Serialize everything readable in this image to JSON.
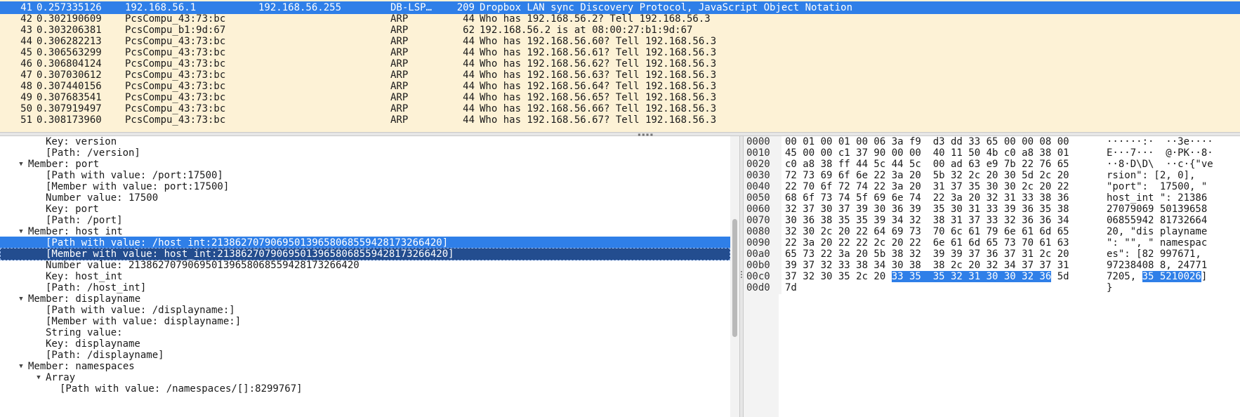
{
  "packet_list": {
    "rows": [
      {
        "no": "41",
        "time": "0.257335126",
        "src": "192.168.56.1",
        "dst": "192.168.56.255",
        "proto": "DB-LSP…",
        "len": "209",
        "info": "Dropbox LAN sync Discovery Protocol, JavaScript Object Notation",
        "selected": true
      },
      {
        "no": "42",
        "time": "0.302190609",
        "src": "PcsCompu_43:73:bc",
        "dst": "",
        "proto": "ARP",
        "len": "44",
        "info": "Who has 192.168.56.2? Tell 192.168.56.3"
      },
      {
        "no": "43",
        "time": "0.303206381",
        "src": "PcsCompu_b1:9d:67",
        "dst": "",
        "proto": "ARP",
        "len": "62",
        "info": "192.168.56.2 is at 08:00:27:b1:9d:67"
      },
      {
        "no": "44",
        "time": "0.306282213",
        "src": "PcsCompu_43:73:bc",
        "dst": "",
        "proto": "ARP",
        "len": "44",
        "info": "Who has 192.168.56.60? Tell 192.168.56.3"
      },
      {
        "no": "45",
        "time": "0.306563299",
        "src": "PcsCompu_43:73:bc",
        "dst": "",
        "proto": "ARP",
        "len": "44",
        "info": "Who has 192.168.56.61? Tell 192.168.56.3"
      },
      {
        "no": "46",
        "time": "0.306804124",
        "src": "PcsCompu_43:73:bc",
        "dst": "",
        "proto": "ARP",
        "len": "44",
        "info": "Who has 192.168.56.62? Tell 192.168.56.3"
      },
      {
        "no": "47",
        "time": "0.307030612",
        "src": "PcsCompu_43:73:bc",
        "dst": "",
        "proto": "ARP",
        "len": "44",
        "info": "Who has 192.168.56.63? Tell 192.168.56.3"
      },
      {
        "no": "48",
        "time": "0.307440156",
        "src": "PcsCompu_43:73:bc",
        "dst": "",
        "proto": "ARP",
        "len": "44",
        "info": "Who has 192.168.56.64? Tell 192.168.56.3"
      },
      {
        "no": "49",
        "time": "0.307683541",
        "src": "PcsCompu_43:73:bc",
        "dst": "",
        "proto": "ARP",
        "len": "44",
        "info": "Who has 192.168.56.65? Tell 192.168.56.3"
      },
      {
        "no": "50",
        "time": "0.307919497",
        "src": "PcsCompu_43:73:bc",
        "dst": "",
        "proto": "ARP",
        "len": "44",
        "info": "Who has 192.168.56.66? Tell 192.168.56.3"
      },
      {
        "no": "51",
        "time": "0.308173960",
        "src": "PcsCompu_43:73:bc",
        "dst": "",
        "proto": "ARP",
        "len": "44",
        "info": "Who has 192.168.56.67? Tell 192.168.56.3"
      }
    ]
  },
  "details": {
    "rows": [
      {
        "text": "Key: version",
        "depth": 2,
        "arrow": ""
      },
      {
        "text": "[Path: /version]",
        "depth": 2,
        "arrow": ""
      },
      {
        "text": "Member: port",
        "depth": 1,
        "arrow": "down"
      },
      {
        "text": "[Path with value: /port:17500]",
        "depth": 2,
        "arrow": ""
      },
      {
        "text": "[Member with value: port:17500]",
        "depth": 2,
        "arrow": ""
      },
      {
        "text": "Number value: 17500",
        "depth": 2,
        "arrow": ""
      },
      {
        "text": "Key: port",
        "depth": 2,
        "arrow": ""
      },
      {
        "text": "[Path: /port]",
        "depth": 2,
        "arrow": ""
      },
      {
        "text": "Member: host_int",
        "depth": 1,
        "arrow": "down"
      },
      {
        "text": "[Path with value: /host_int:213862707906950139658068559428173266420]",
        "depth": 2,
        "arrow": "",
        "state": "selected"
      },
      {
        "text": "[Member with value: host_int:213862707906950139658068559428173266420]",
        "depth": 2,
        "arrow": "",
        "state": "related"
      },
      {
        "text": "Number value: 213862707906950139658068559428173266420",
        "depth": 2,
        "arrow": ""
      },
      {
        "text": "Key: host_int",
        "depth": 2,
        "arrow": ""
      },
      {
        "text": "[Path: /host_int]",
        "depth": 2,
        "arrow": ""
      },
      {
        "text": "Member: displayname",
        "depth": 1,
        "arrow": "down"
      },
      {
        "text": "[Path with value: /displayname:]",
        "depth": 2,
        "arrow": ""
      },
      {
        "text": "[Member with value: displayname:]",
        "depth": 2,
        "arrow": ""
      },
      {
        "text": "String value:",
        "depth": 2,
        "arrow": ""
      },
      {
        "text": "Key: displayname",
        "depth": 2,
        "arrow": ""
      },
      {
        "text": "[Path: /displayname]",
        "depth": 2,
        "arrow": ""
      },
      {
        "text": "Member: namespaces",
        "depth": 1,
        "arrow": "down"
      },
      {
        "text": "Array",
        "depth": 2,
        "arrow": "down"
      },
      {
        "text": "[Path with value: /namespaces/[]:8299767]",
        "depth": 3,
        "arrow": ""
      }
    ]
  },
  "bytes": {
    "rows": [
      {
        "offset": "0000",
        "hex": "00 01 00 01 00 06 3a f9  d3 dd 33 65 00 00 08 00",
        "ascii": "······:·  ··3e····"
      },
      {
        "offset": "0010",
        "hex": "45 00 00 c1 37 90 00 00  40 11 50 4b c0 a8 38 01",
        "ascii": "E···7···  @·PK··8·"
      },
      {
        "offset": "0020",
        "hex": "c0 a8 38 ff 44 5c 44 5c  00 ad 63 e9 7b 22 76 65",
        "ascii": "··8·D\\D\\  ··c·{\"ve"
      },
      {
        "offset": "0030",
        "hex": "72 73 69 6f 6e 22 3a 20  5b 32 2c 20 30 5d 2c 20",
        "ascii": "rsion\": [2, 0],"
      },
      {
        "offset": "0040",
        "hex": "22 70 6f 72 74 22 3a 20  31 37 35 30 30 2c 20 22",
        "ascii": "\"port\":  17500, \""
      },
      {
        "offset": "0050",
        "hex": "68 6f 73 74 5f 69 6e 74  22 3a 20 32 31 33 38 36",
        "ascii": "host_int \": 21386"
      },
      {
        "offset": "0060",
        "hex": "32 37 30 37 39 30 36 39  35 30 31 33 39 36 35 38",
        "ascii": "27079069 50139658"
      },
      {
        "offset": "0070",
        "hex": "30 36 38 35 35 39 34 32  38 31 37 33 32 36 36 34",
        "ascii": "06855942 81732664"
      },
      {
        "offset": "0080",
        "hex": "32 30 2c 20 22 64 69 73  70 6c 61 79 6e 61 6d 65",
        "ascii": "20, \"dis playname"
      },
      {
        "offset": "0090",
        "hex": "22 3a 20 22 22 2c 20 22  6e 61 6d 65 73 70 61 63",
        "ascii": "\": \"\", \" namespac"
      },
      {
        "offset": "00a0",
        "hex": "65 73 22 3a 20 5b 38 32  39 39 37 36 37 31 2c 20",
        "ascii": "es\": [82 997671,"
      },
      {
        "offset": "00b0",
        "hex": "39 37 32 33 38 34 30 38  38 2c 20 32 34 37 37 31",
        "ascii": "97238408 8, 24771"
      },
      {
        "offset": "00c0",
        "hex_pre": "37 32 30 35 2c 20 ",
        "hex_hl": "33 35  35 32 31 30 30 32 36",
        "hex_post": " 5d",
        "ascii_pre": "7205, ",
        "ascii_hl": "35 5210026",
        "ascii_post": "]"
      },
      {
        "offset": "00d0",
        "hex": "7d",
        "ascii": "}"
      }
    ]
  }
}
